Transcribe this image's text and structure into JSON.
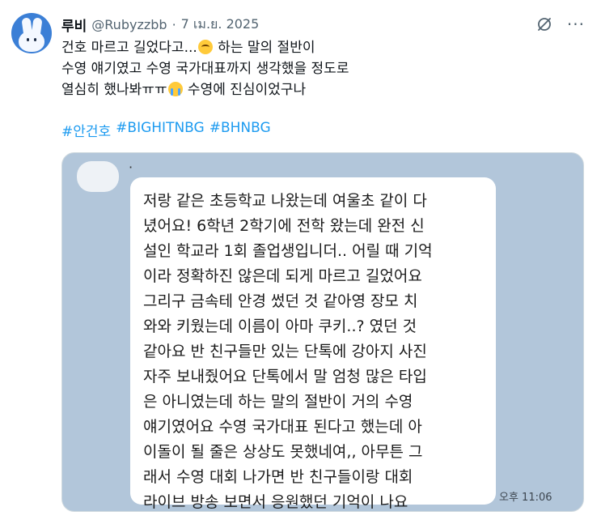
{
  "user": {
    "display_name": "루비",
    "handle": "@Rubyzzbb",
    "separator": "·",
    "date": "7 เม.ย. 2025"
  },
  "header_icons": [
    "grok-icon",
    "more-icon"
  ],
  "more_glyph": "···",
  "tweet": {
    "lines": [
      {
        "before": "건호 마르고 길었다고...",
        "emoji": "pleading-face-emoji",
        "after": " 하는 말의 절반이"
      },
      {
        "before": "수영 얘기였고 수영 국가대표까지 생각했을 정도로",
        "emoji": "",
        "after": ""
      },
      {
        "before": "열심히 했나봐ㅠㅠ",
        "emoji": "crying-face-emoji",
        "after": " 수영에 진심이었구나"
      }
    ],
    "hashtags": [
      "#안건호",
      "#BIGHITNBG",
      "#BHNBG"
    ]
  },
  "chat": {
    "bullet": "·",
    "message_lines": [
      "저랑 같은 초등학교 나왔는데 여울초 같이 다",
      "녔어요! 6학년 2학기에 전학 왔는데 완전 신",
      "설인 학교라 1회 졸업생입니더.. 어릴 때 기억",
      "이라 정확하진 않은데 되게 마르고 길었어요",
      "그리구 금속테 안경 썼던 것 같아영 장모 치",
      "와와 키웠는데 이름이 아마 쿠키..? 였던 것",
      "같아요 반 친구들만 있는 단톡에 강아지 사진",
      "자주 보내줬어요 단톡에서 말 엄청 많은 타입",
      "은 아니였는데 하는 말의 절반이 거의 수영",
      "얘기였어요 수영 국가대표 된다고 했는데 아",
      "이돌이 될 줄은 상상도 못했네여,, 아무튼 그",
      "래서 수영 대회 나가면 반 친구들이랑 대회",
      "라이브 방송 보면서 응원했던 기억이 나요"
    ],
    "time": "오후 11:06"
  },
  "colors": {
    "accent": "#1d9bf0",
    "secondary_text": "#536471",
    "chat_background": "#b2c6da",
    "avatar": "#3b7fd6"
  }
}
